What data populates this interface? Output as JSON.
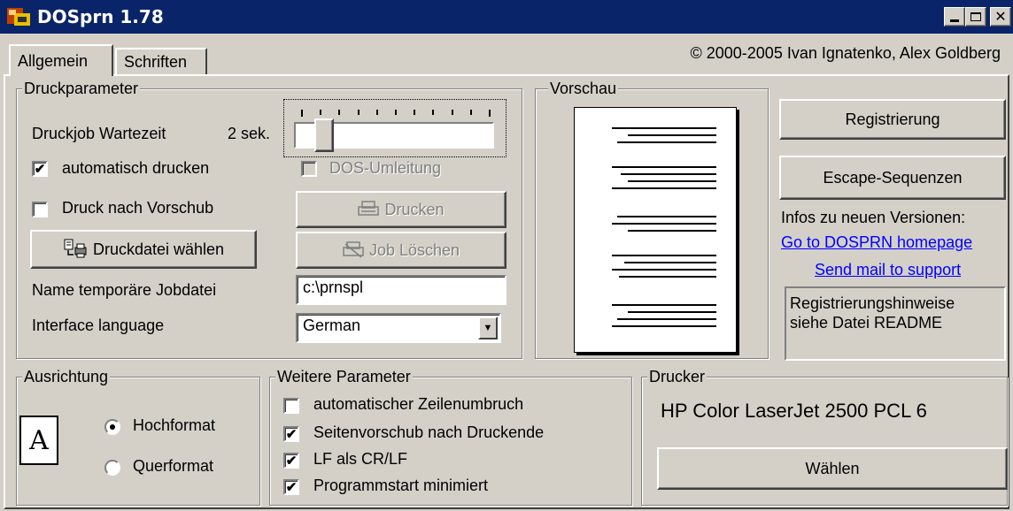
{
  "window": {
    "title": "DOSprn 1.78",
    "minimize_icon": "minimize-icon",
    "maximize_icon": "maximize-icon",
    "close_icon": "close-icon"
  },
  "tabs": [
    {
      "label": "Allgemein",
      "active": true
    },
    {
      "label": "Schriften",
      "active": false
    }
  ],
  "copyright": "© 2000-2005 Ivan Ignatenko, Alex Goldberg",
  "druckparameter": {
    "title": "Druckparameter",
    "wait_label": "Druckjob Wartezeit",
    "wait_value": "2 sek.",
    "auto_print": {
      "label": "automatisch drucken",
      "checked": true
    },
    "dos_redirect": {
      "label": "DOS-Umleitung",
      "checked": false,
      "disabled": true
    },
    "print_after_feed": {
      "label": "Druck nach Vorschub",
      "checked": false
    },
    "print_button": "Drucken",
    "select_file_button": "Druckdatei wählen",
    "delete_job_button": "Job Löschen",
    "temp_file_label": "Name temporäre Jobdatei",
    "temp_file_value": "c:\\prnspl",
    "language_label": "Interface language",
    "language_value": "German"
  },
  "vorschau": {
    "title": "Vorschau"
  },
  "right_panel": {
    "register_button": "Registrierung",
    "escape_button": "Escape-Sequenzen",
    "versions_label": "Infos zu neuen Versionen:",
    "homepage_link": "Go to DOSPRN homepage",
    "mail_link": "Send mail to support",
    "reg_hint_line1": "Registrierungshinweise",
    "reg_hint_line2": "siehe Datei README"
  },
  "ausrichtung": {
    "title": "Ausrichtung",
    "portrait": {
      "label": "Hochformat",
      "selected": true
    },
    "landscape": {
      "label": "Querformat",
      "selected": false
    },
    "icon_letter": "A"
  },
  "weitere": {
    "title": "Weitere Parameter",
    "options": [
      {
        "label": "automatischer Zeilenumbruch",
        "checked": false
      },
      {
        "label": "Seitenvorschub nach Druckende",
        "checked": true
      },
      {
        "label": "LF als CR/LF",
        "checked": true
      },
      {
        "label": "Programmstart minimiert",
        "checked": true
      }
    ]
  },
  "drucker": {
    "title": "Drucker",
    "printer_name": "HP Color LaserJet 2500 PCL 6",
    "choose_button": "Wählen"
  },
  "colors": {
    "titlebar": "#0a246a",
    "face": "#d4d0c8",
    "link": "#0000ff"
  },
  "slider": {
    "position_ticks": 1,
    "tick_count": 11
  }
}
